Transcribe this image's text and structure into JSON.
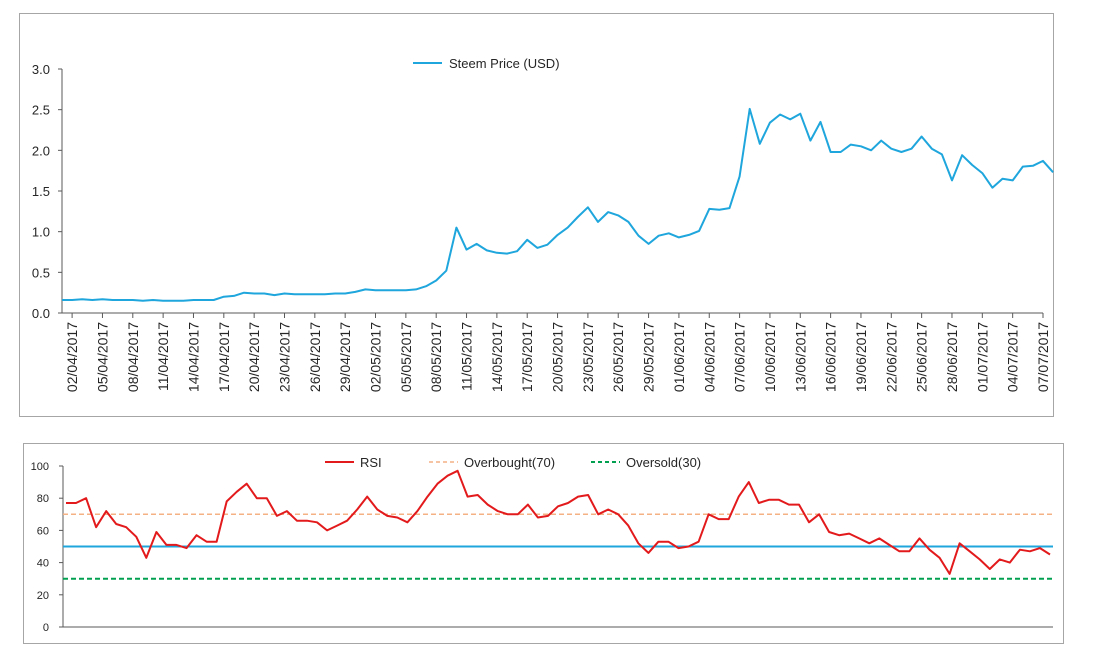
{
  "chart_data": [
    {
      "type": "line",
      "title": "",
      "xlabel": "",
      "ylabel": "",
      "ylim": [
        0,
        3
      ],
      "yticks": [
        "0.0",
        "0.5",
        "1.0",
        "1.5",
        "2.0",
        "2.5",
        "3.0"
      ],
      "grid": false,
      "legend_position": "top-center",
      "color": "#1fa6dc",
      "x": [
        "01/04/2017",
        "02/04/2017",
        "03/04/2017",
        "04/04/2017",
        "05/04/2017",
        "06/04/2017",
        "07/04/2017",
        "08/04/2017",
        "09/04/2017",
        "10/04/2017",
        "11/04/2017",
        "12/04/2017",
        "13/04/2017",
        "14/04/2017",
        "15/04/2017",
        "16/04/2017",
        "17/04/2017",
        "18/04/2017",
        "19/04/2017",
        "20/04/2017",
        "21/04/2017",
        "22/04/2017",
        "23/04/2017",
        "24/04/2017",
        "25/04/2017",
        "26/04/2017",
        "27/04/2017",
        "28/04/2017",
        "29/04/2017",
        "30/04/2017",
        "01/05/2017",
        "02/05/2017",
        "03/05/2017",
        "04/05/2017",
        "05/05/2017",
        "06/05/2017",
        "07/05/2017",
        "08/05/2017",
        "09/05/2017",
        "10/05/2017",
        "11/05/2017",
        "12/05/2017",
        "13/05/2017",
        "14/05/2017",
        "15/05/2017",
        "16/05/2017",
        "17/05/2017",
        "18/05/2017",
        "19/05/2017",
        "20/05/2017",
        "21/05/2017",
        "22/05/2017",
        "23/05/2017",
        "24/05/2017",
        "25/05/2017",
        "26/05/2017",
        "27/05/2017",
        "28/05/2017",
        "29/05/2017",
        "30/05/2017",
        "31/05/2017",
        "01/06/2017",
        "02/06/2017",
        "03/06/2017",
        "04/06/2017",
        "05/06/2017",
        "06/06/2017",
        "07/06/2017",
        "08/06/2017",
        "09/06/2017",
        "10/06/2017",
        "11/06/2017",
        "12/06/2017",
        "13/06/2017",
        "14/06/2017",
        "15/06/2017",
        "16/06/2017",
        "17/06/2017",
        "18/06/2017",
        "19/06/2017",
        "20/06/2017",
        "21/06/2017",
        "22/06/2017",
        "23/06/2017",
        "24/06/2017",
        "25/06/2017",
        "26/06/2017",
        "27/06/2017",
        "28/06/2017",
        "29/06/2017",
        "30/06/2017",
        "01/07/2017",
        "02/07/2017",
        "03/07/2017",
        "04/07/2017",
        "05/07/2017",
        "06/07/2017",
        "07/07/2017"
      ],
      "xtick_labels": [
        "02/04/2017",
        "05/04/2017",
        "08/04/2017",
        "11/04/2017",
        "14/04/2017",
        "17/04/2017",
        "20/04/2017",
        "23/04/2017",
        "26/04/2017",
        "29/04/2017",
        "02/05/2017",
        "05/05/2017",
        "08/05/2017",
        "11/05/2017",
        "14/05/2017",
        "17/05/2017",
        "20/05/2017",
        "23/05/2017",
        "26/05/2017",
        "29/05/2017",
        "01/06/2017",
        "04/06/2017",
        "07/06/2017",
        "10/06/2017",
        "13/06/2017",
        "16/06/2017",
        "19/06/2017",
        "22/06/2017",
        "25/06/2017",
        "28/06/2017",
        "01/07/2017",
        "04/07/2017",
        "07/07/2017"
      ],
      "series": [
        {
          "name": "Steem Price (USD)",
          "values": [
            0.16,
            0.16,
            0.17,
            0.16,
            0.17,
            0.16,
            0.16,
            0.16,
            0.15,
            0.16,
            0.15,
            0.15,
            0.15,
            0.16,
            0.16,
            0.16,
            0.2,
            0.21,
            0.25,
            0.24,
            0.24,
            0.22,
            0.24,
            0.23,
            0.23,
            0.23,
            0.23,
            0.24,
            0.24,
            0.26,
            0.29,
            0.28,
            0.28,
            0.28,
            0.28,
            0.29,
            0.33,
            0.4,
            0.52,
            1.05,
            0.78,
            0.85,
            0.77,
            0.74,
            0.73,
            0.76,
            0.9,
            0.8,
            0.84,
            0.96,
            1.05,
            1.18,
            1.3,
            1.12,
            1.24,
            1.2,
            1.12,
            0.95,
            0.85,
            0.95,
            0.98,
            0.93,
            0.96,
            1.01,
            1.28,
            1.27,
            1.29,
            1.68,
            2.51,
            2.08,
            2.34,
            2.44,
            2.38,
            2.45,
            2.12,
            2.35,
            1.98,
            1.98,
            2.07,
            2.05,
            2.0,
            2.12,
            2.02,
            1.98,
            2.02,
            2.17,
            2.02,
            1.95,
            1.63,
            1.94,
            1.82,
            1.72,
            1.54,
            1.65,
            1.63,
            1.8,
            1.81,
            1.87,
            1.73
          ]
        }
      ]
    },
    {
      "type": "line",
      "title": "",
      "xlabel": "",
      "ylabel": "",
      "ylim": [
        0,
        100
      ],
      "yticks": [
        "0",
        "20",
        "40",
        "60",
        "80",
        "100"
      ],
      "grid": false,
      "legend_position": "top-center",
      "reference_line": 50,
      "series": [
        {
          "name": "RSI",
          "color": "#e31a1c",
          "values": [
            77,
            77,
            80,
            62,
            72,
            64,
            62,
            56,
            43,
            59,
            51,
            51,
            49,
            57,
            53,
            53,
            78,
            84,
            89,
            80,
            80,
            69,
            72,
            66,
            66,
            65,
            60,
            63,
            66,
            73,
            81,
            73,
            69,
            68,
            65,
            72,
            81,
            89,
            94,
            97,
            81,
            82,
            76,
            72,
            70,
            70,
            76,
            68,
            69,
            75,
            77,
            81,
            82,
            70,
            73,
            70,
            63,
            52,
            46,
            53,
            53,
            49,
            50,
            53,
            70,
            67,
            67,
            81,
            90,
            77,
            79,
            79,
            76,
            76,
            65,
            70,
            59,
            57,
            58,
            55,
            52,
            55,
            51,
            47,
            47,
            55,
            48,
            43,
            33,
            52,
            47,
            42,
            36,
            42,
            40,
            48,
            47,
            49,
            45
          ]
        },
        {
          "name": "Overbought(70)",
          "color": "#f4b183",
          "value": 70
        },
        {
          "name": "Oversold(30)",
          "color": "#00a050",
          "value": 30
        }
      ]
    }
  ]
}
